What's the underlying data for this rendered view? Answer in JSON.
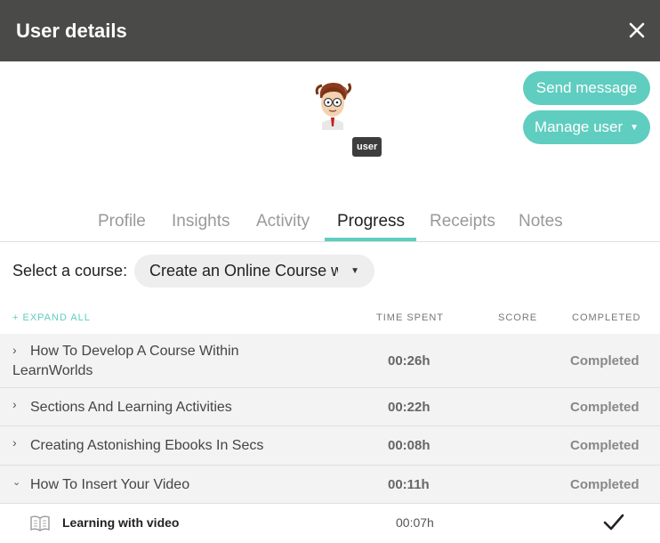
{
  "header": {
    "title": "User details",
    "close_icon": "close-icon"
  },
  "profile": {
    "avatar_icon": "cartoon-avatar",
    "role_badge": "user"
  },
  "actions": {
    "send_message_label": "Send message",
    "manage_user_label": "Manage user",
    "accent_color": "#5fcdbf"
  },
  "tabs": [
    {
      "label": "Profile"
    },
    {
      "label": "Insights"
    },
    {
      "label": "Activity"
    },
    {
      "label": "Progress",
      "active": true
    },
    {
      "label": "Receipts"
    },
    {
      "label": "Notes"
    }
  ],
  "course_select": {
    "label": "Select a course:",
    "value": "Create an Online Course w"
  },
  "table": {
    "expand_all": "+ EXPAND ALL",
    "columns": {
      "time_spent": "TIME SPENT",
      "score": "SCORE",
      "completed": "COMPLETED"
    },
    "rows": [
      {
        "title": "How To Develop A Course Within LearnWorlds",
        "time": "00:26h",
        "score": "",
        "status": "Completed",
        "expanded": false
      },
      {
        "title": "Sections And Learning Activities",
        "time": "00:22h",
        "score": "",
        "status": "Completed",
        "expanded": false
      },
      {
        "title": "Creating Astonishing Ebooks In Secs",
        "time": "00:08h",
        "score": "",
        "status": "Completed",
        "expanded": false
      },
      {
        "title": "How To Insert Your Video",
        "time": "00:11h",
        "score": "",
        "status": "Completed",
        "expanded": true
      }
    ],
    "sub_rows": [
      {
        "title": "Learning with video",
        "time": "00:07h",
        "icon": "ebook-icon",
        "completed_icon": "checkmark-icon"
      }
    ]
  }
}
